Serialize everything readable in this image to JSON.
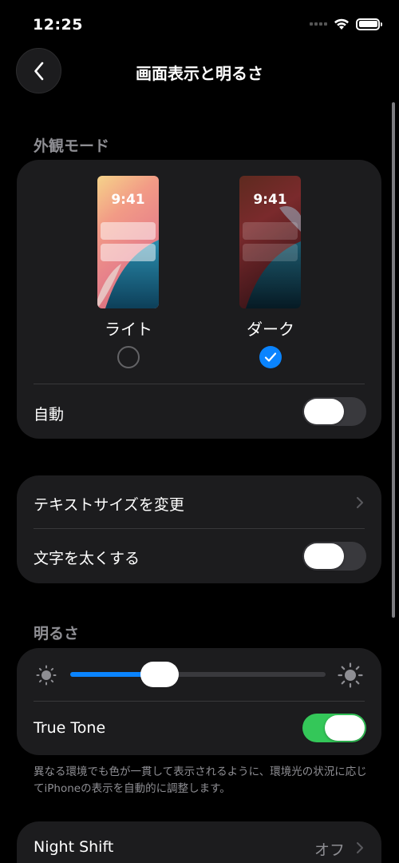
{
  "status_bar": {
    "time": "12:25"
  },
  "nav": {
    "title": "画面表示と明るさ"
  },
  "appearance": {
    "header": "外観モード",
    "options": [
      {
        "label": "ライト",
        "preview_time": "9:41",
        "selected": false
      },
      {
        "label": "ダーク",
        "preview_time": "9:41",
        "selected": true
      }
    ],
    "auto_label": "自動",
    "auto_on": false
  },
  "text_settings": {
    "text_size_label": "テキストサイズを変更",
    "bold_text_label": "文字を太くする",
    "bold_text_on": false
  },
  "brightness": {
    "header": "明るさ",
    "level_percent": 35,
    "true_tone_label": "True Tone",
    "true_tone_on": true,
    "footnote": "異なる環境でも色が一貫して表示されるように、環境光の状況に応じてiPhoneの表示を自動的に調整します。"
  },
  "night_shift": {
    "label": "Night Shift",
    "value": "オフ"
  },
  "colors": {
    "accent": "#0a84ff",
    "toggle_on": "#34c759",
    "card_bg": "#1c1c1e",
    "secondary_text": "#8e8e93"
  }
}
